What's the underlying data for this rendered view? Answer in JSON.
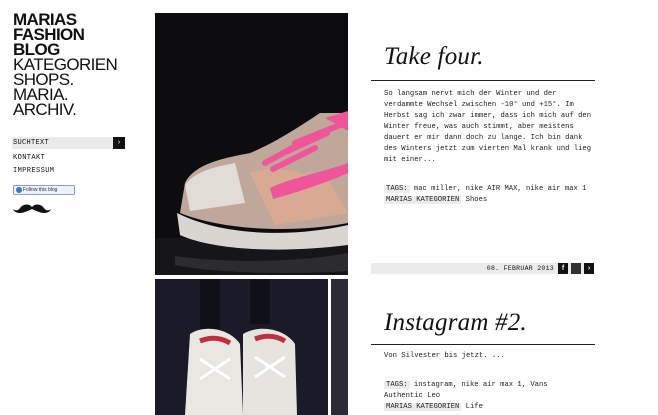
{
  "sidebar": {
    "brand_lines": [
      "MARIAS",
      "FASHION",
      "BLOG"
    ],
    "nav": [
      "KATEGORIEN",
      "SHOPS.",
      "MARIA.",
      "ARCHIV."
    ],
    "search_placeholder": "SUCHTEXT",
    "search_button": "›",
    "links": [
      "KONTAKT",
      "IMPRESSUM"
    ],
    "follow_label": "Follow this blog"
  },
  "posts": [
    {
      "title": "Take four.",
      "body": "So langsam nervt mich der Winter und der verdammte Wechsel zwischen -10° und +15°. Im Herbst sag ich zwar immer, dass ich mich auf den Winter freue, was auch stimmt, aber meistens dauert er mir dann doch zu lange. Ich bin dank des Winters jetzt zum vierten Mal krank und lieg mit einer...",
      "tags_label": "TAGS:",
      "tags": "mac miller, nike AIR MAX, nike air max 1",
      "category_label": "MARIAS KATEGORIEN",
      "category": "Shoes",
      "date": "08. FEBRUAR 2013",
      "share_fb": "f",
      "share_other": "",
      "share_next": "›"
    },
    {
      "title": "Instagram #2.",
      "body": "Von Silvester bis jetzt. ...",
      "tags_label": "TAGS:",
      "tags": "instagram, nike air max 1, Vans",
      "tags2": "Authentic Leo",
      "category_label": "MARIAS KATEGORIEN",
      "category": "Life"
    }
  ],
  "colors": {
    "accent_pink": "#f0559a",
    "sidebar_gray": "#ebebeb"
  }
}
